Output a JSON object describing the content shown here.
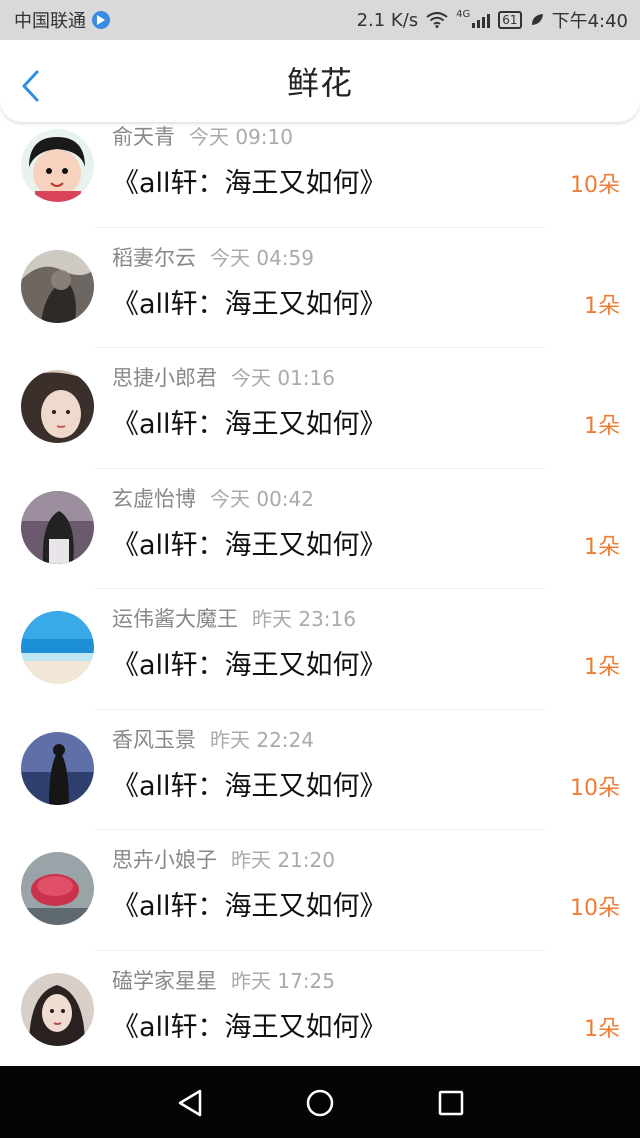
{
  "status_bar": {
    "carrier": "中国联通",
    "speed": "2.1 K/s",
    "network": "4G",
    "battery": "61",
    "time": "下午4:40"
  },
  "nav": {
    "title": "鲜花"
  },
  "list": [
    {
      "name": "俞天青",
      "time": "今天 09:10",
      "title": "《all轩：海王又如何》",
      "count": "10朵"
    },
    {
      "name": "稻妻尔云",
      "time": "今天 04:59",
      "title": "《all轩：海王又如何》",
      "count": "1朵"
    },
    {
      "name": "思捷小郎君",
      "time": "今天 01:16",
      "title": "《all轩：海王又如何》",
      "count": "1朵"
    },
    {
      "name": "玄虚怡博",
      "time": "今天 00:42",
      "title": "《all轩：海王又如何》",
      "count": "1朵"
    },
    {
      "name": "运伟酱大魔王",
      "time": "昨天 23:16",
      "title": "《all轩：海王又如何》",
      "count": "1朵"
    },
    {
      "name": "香风玉景",
      "time": "昨天 22:24",
      "title": "《all轩：海王又如何》",
      "count": "10朵"
    },
    {
      "name": "思卉小娘子",
      "time": "昨天 21:20",
      "title": "《all轩：海王又如何》",
      "count": "10朵"
    },
    {
      "name": "磕学家星星",
      "time": "昨天 17:25",
      "title": "《all轩：海王又如何》",
      "count": "1朵"
    }
  ],
  "colors": {
    "accent": "#2f8de4",
    "count": "#f07c34"
  }
}
